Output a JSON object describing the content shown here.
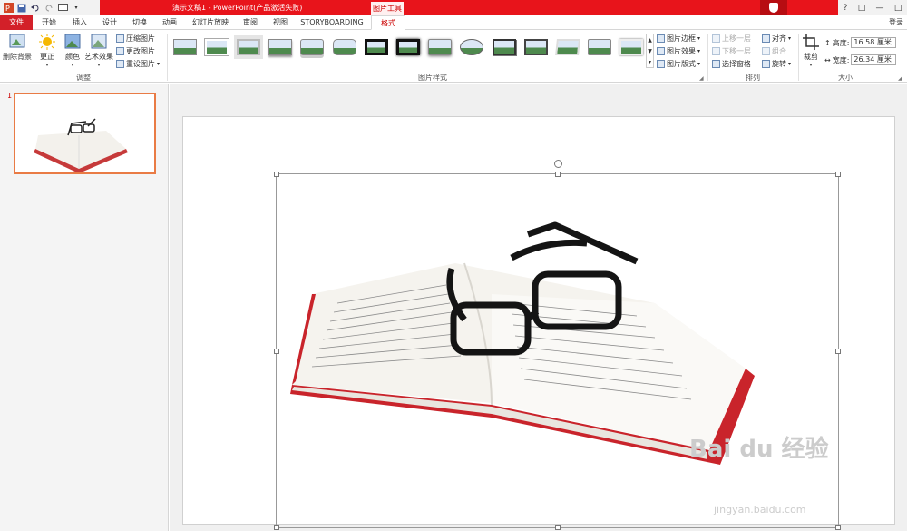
{
  "titlebar": {
    "doc_title": "演示文稿1 - PowerPoint(产品激活失败)",
    "context_tab": "图片工具",
    "help": "?",
    "window_buttons": [
      "□",
      "—",
      "□",
      "✕"
    ]
  },
  "tabs": [
    "文件",
    "开始",
    "插入",
    "设计",
    "切换",
    "动画",
    "幻灯片放映",
    "审阅",
    "视图",
    "STORYBOARDING",
    "格式"
  ],
  "login": "登录",
  "ribbon": {
    "adjust": {
      "remove_bg": "删除背景",
      "corrections": "更正",
      "color": "颜色",
      "artistic": "艺术效果",
      "compress": "压缩图片",
      "change": "更改图片",
      "reset": "重设图片",
      "label": "调整"
    },
    "styles": {
      "label": "图片样式",
      "border": "图片边框",
      "effects": "图片效果",
      "layout": "图片版式"
    },
    "arrange": {
      "bring_forward": "上移一层",
      "send_backward": "下移一层",
      "selection_pane": "选择窗格",
      "align": "对齐",
      "group": "组合",
      "rotate": "旋转",
      "label": "排列"
    },
    "size": {
      "crop": "裁剪",
      "height_label": "高度:",
      "height_value": "16.58 厘米",
      "width_label": "宽度:",
      "width_value": "26.34 厘米",
      "label": "大小"
    }
  },
  "slides": {
    "number": "1"
  },
  "watermark": {
    "brand": "Bai du 经验",
    "url": "jingyan.baidu.com"
  },
  "colors": {
    "accent": "#e8141b",
    "thumb_border": "#e97b45"
  }
}
